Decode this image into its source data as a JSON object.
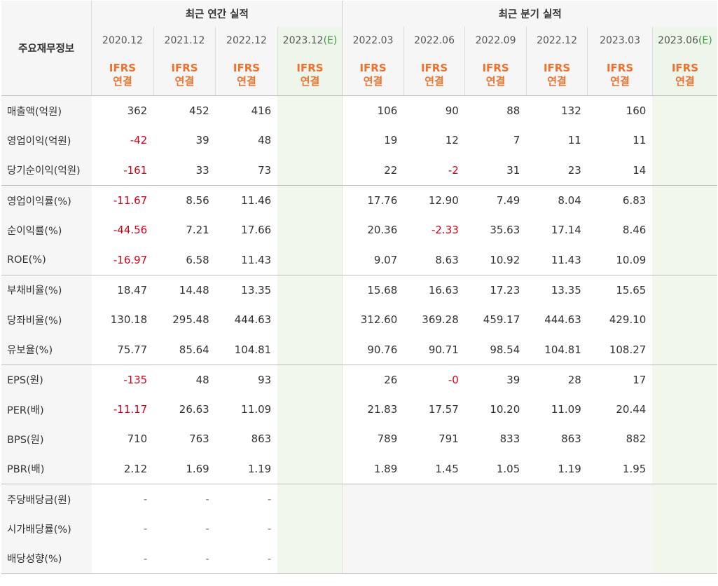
{
  "header": {
    "label_col": "주요재무정보",
    "annual_group": "최근 연간 실적",
    "quarter_group": "최근 분기 실적",
    "annual_dates": [
      {
        "date": "2020.12",
        "est": ""
      },
      {
        "date": "2021.12",
        "est": ""
      },
      {
        "date": "2022.12",
        "est": ""
      },
      {
        "date": "2023.12",
        "est": "(E)"
      }
    ],
    "quarter_dates": [
      {
        "date": "2022.03",
        "est": ""
      },
      {
        "date": "2022.06",
        "est": ""
      },
      {
        "date": "2022.09",
        "est": ""
      },
      {
        "date": "2022.12",
        "est": ""
      },
      {
        "date": "2023.03",
        "est": ""
      },
      {
        "date": "2023.06",
        "est": "(E)"
      }
    ],
    "ifrs_line1": "IFRS",
    "ifrs_line2": "연결"
  },
  "rows": [
    {
      "label": "매출액(억원)",
      "annual": [
        "362",
        "452",
        "416",
        ""
      ],
      "quarter": [
        "106",
        "90",
        "88",
        "132",
        "160",
        ""
      ]
    },
    {
      "label": "영업이익(억원)",
      "annual": [
        "-42",
        "39",
        "48",
        ""
      ],
      "quarter": [
        "19",
        "12",
        "7",
        "11",
        "11",
        ""
      ]
    },
    {
      "label": "당기순이익(억원)",
      "annual": [
        "-161",
        "33",
        "73",
        ""
      ],
      "quarter": [
        "22",
        "-2",
        "31",
        "23",
        "14",
        ""
      ]
    },
    {
      "label": "영업이익률(%)",
      "annual": [
        "-11.67",
        "8.56",
        "11.46",
        ""
      ],
      "quarter": [
        "17.76",
        "12.90",
        "7.49",
        "8.04",
        "6.83",
        ""
      ]
    },
    {
      "label": "순이익률(%)",
      "annual": [
        "-44.56",
        "7.21",
        "17.66",
        ""
      ],
      "quarter": [
        "20.36",
        "-2.33",
        "35.63",
        "17.14",
        "8.46",
        ""
      ]
    },
    {
      "label": "ROE(%)",
      "annual": [
        "-16.97",
        "6.58",
        "11.43",
        ""
      ],
      "quarter": [
        "9.07",
        "8.63",
        "10.92",
        "11.43",
        "10.09",
        ""
      ]
    },
    {
      "label": "부채비율(%)",
      "annual": [
        "18.47",
        "14.48",
        "13.35",
        ""
      ],
      "quarter": [
        "15.68",
        "16.63",
        "17.23",
        "13.35",
        "15.65",
        ""
      ]
    },
    {
      "label": "당좌비율(%)",
      "annual": [
        "130.18",
        "295.48",
        "444.63",
        ""
      ],
      "quarter": [
        "312.60",
        "369.28",
        "459.17",
        "444.63",
        "429.10",
        ""
      ]
    },
    {
      "label": "유보율(%)",
      "annual": [
        "75.77",
        "85.64",
        "104.81",
        ""
      ],
      "quarter": [
        "90.76",
        "90.71",
        "98.54",
        "104.81",
        "108.27",
        ""
      ]
    },
    {
      "label": "EPS(원)",
      "annual": [
        "-135",
        "48",
        "93",
        ""
      ],
      "quarter": [
        "26",
        "-0",
        "39",
        "28",
        "17",
        ""
      ]
    },
    {
      "label": "PER(배)",
      "annual": [
        "-11.17",
        "26.63",
        "11.09",
        ""
      ],
      "quarter": [
        "21.83",
        "17.57",
        "10.20",
        "11.09",
        "20.44",
        ""
      ]
    },
    {
      "label": "BPS(원)",
      "annual": [
        "710",
        "763",
        "863",
        ""
      ],
      "quarter": [
        "789",
        "791",
        "833",
        "863",
        "882",
        ""
      ]
    },
    {
      "label": "PBR(배)",
      "annual": [
        "2.12",
        "1.69",
        "1.19",
        ""
      ],
      "quarter": [
        "1.89",
        "1.45",
        "1.05",
        "1.19",
        "1.95",
        ""
      ]
    },
    {
      "label": "주당배당금(원)",
      "annual": [
        "-",
        "-",
        "-",
        ""
      ],
      "quarter": [
        "",
        "",
        "",
        "",
        "",
        ""
      ]
    },
    {
      "label": "시가배당률(%)",
      "annual": [
        "-",
        "-",
        "-",
        ""
      ],
      "quarter": [
        "",
        "",
        "",
        "",
        "",
        ""
      ]
    },
    {
      "label": "배당성향(%)",
      "annual": [
        "-",
        "-",
        "-",
        ""
      ],
      "quarter": [
        "",
        "",
        "",
        "",
        "",
        ""
      ]
    }
  ],
  "colors": {
    "negative": "#d0021b",
    "ifrs": "#f0702d",
    "estimate_bg": "#f2f7ee",
    "estimate_tag": "#3c9a3c"
  }
}
